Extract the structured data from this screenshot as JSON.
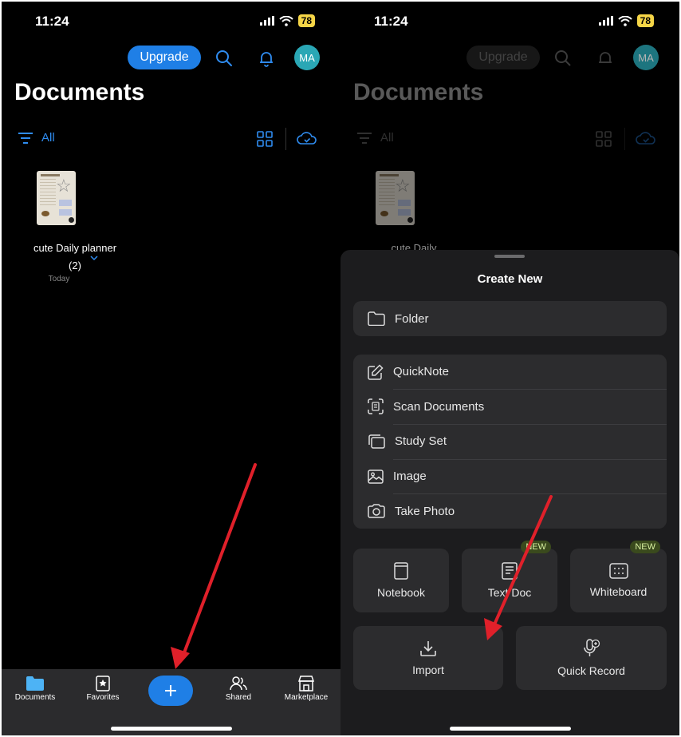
{
  "status_bar": {
    "time": "11:24",
    "battery": "78"
  },
  "header": {
    "upgrade_label": "Upgrade",
    "avatar_initials": "MA",
    "title": "Documents"
  },
  "filter": {
    "label": "All"
  },
  "document": {
    "name": "cute Daily planner (2)",
    "name_truncated": "cute Daily",
    "date": "Today"
  },
  "tabbar": {
    "tabs": [
      {
        "label": "Documents",
        "icon": "folder-icon"
      },
      {
        "label": "Favorites",
        "icon": "star-bookmark-icon"
      },
      {
        "label": "Shared",
        "icon": "people-icon"
      },
      {
        "label": "Marketplace",
        "icon": "store-icon"
      }
    ]
  },
  "create_sheet": {
    "title": "Create New",
    "folder_label": "Folder",
    "list_items": [
      {
        "label": "QuickNote",
        "icon": "pencil-square-icon"
      },
      {
        "label": "Scan Documents",
        "icon": "scan-icon"
      },
      {
        "label": "Study Set",
        "icon": "cards-icon"
      },
      {
        "label": "Image",
        "icon": "image-icon"
      },
      {
        "label": "Take Photo",
        "icon": "camera-icon"
      }
    ],
    "tiles": [
      {
        "label": "Notebook",
        "icon": "notebook-icon",
        "badge": ""
      },
      {
        "label": "Text Doc",
        "icon": "text-doc-icon",
        "badge": "NEW"
      },
      {
        "label": "Whiteboard",
        "icon": "whiteboard-icon",
        "badge": "NEW"
      },
      {
        "label": "Import",
        "icon": "download-icon",
        "badge": ""
      },
      {
        "label": "Quick Record",
        "icon": "mic-plus-icon",
        "badge": ""
      }
    ]
  },
  "colors": {
    "accent": "#1f7fe6",
    "background": "#000000",
    "sheet": "#1c1c1e",
    "annotation_arrow": "#e0202a"
  }
}
